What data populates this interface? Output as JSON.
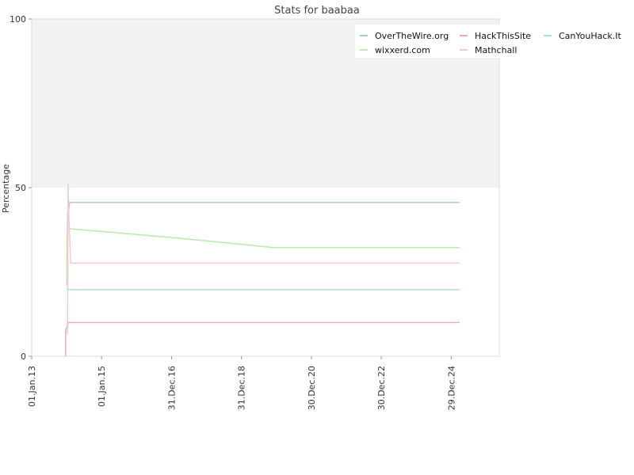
{
  "chart_data": {
    "type": "line",
    "title": "Stats for baabaa",
    "xlabel": "",
    "ylabel": "Percentage",
    "ylim": [
      0,
      100
    ],
    "yticks": [
      "0",
      "50",
      "100"
    ],
    "xlim": [
      "2013-01-01",
      "2026-05-15"
    ],
    "xticks": [
      {
        "label": "01.Jan.13",
        "date": "2013-01-01"
      },
      {
        "label": "01.Jan.15",
        "date": "2015-01-01"
      },
      {
        "label": "31.Dec.16",
        "date": "2016-12-31"
      },
      {
        "label": "31.Dec.18",
        "date": "2018-12-31"
      },
      {
        "label": "30.Dec.20",
        "date": "2020-12-30"
      },
      {
        "label": "30.Dec.22",
        "date": "2022-12-30"
      },
      {
        "label": "29.Dec.24",
        "date": "2024-12-29"
      }
    ],
    "shaded_band": [
      50,
      100
    ],
    "grid": false,
    "legend_position": "top-right",
    "series": [
      {
        "name": "OverTheWire.org",
        "color": "#a7c7e7",
        "points": [
          [
            "2014-01-05",
            31.0
          ],
          [
            "2014-01-12",
            42.7
          ],
          [
            "2014-01-20",
            43.0
          ],
          [
            "2014-02-01",
            45.6
          ],
          [
            "2025-03-26",
            45.6
          ]
        ]
      },
      {
        "name": "HackThisSite",
        "color": "#f4a6c6",
        "points": [
          [
            "2013-12-20",
            0.0
          ],
          [
            "2013-12-21",
            8.0
          ],
          [
            "2014-01-05",
            8.5
          ],
          [
            "2014-01-08",
            9.5
          ],
          [
            "2014-01-25",
            10.0
          ],
          [
            "2025-03-26",
            10.0
          ]
        ]
      },
      {
        "name": "CanYouHack.It",
        "color": "#a8e6cf",
        "points": [
          [
            "2013-12-28",
            20.0
          ],
          [
            "2014-01-15",
            19.8
          ],
          [
            "2025-03-26",
            19.8
          ]
        ]
      },
      {
        "name": "wixxerd.com",
        "color": "#b7eba7",
        "points": [
          [
            "2014-01-02",
            21.0
          ],
          [
            "2014-01-04",
            33.0
          ],
          [
            "2014-01-07",
            37.0
          ],
          [
            "2014-02-05",
            37.8
          ],
          [
            "2015-01-01",
            37.0
          ],
          [
            "2016-12-31",
            35.2
          ],
          [
            "2018-12-31",
            33.2
          ],
          [
            "2019-12-01",
            32.2
          ],
          [
            "2025-03-26",
            32.2
          ]
        ]
      },
      {
        "name": "Mathchall",
        "color": "#f8c8cc",
        "points": [
          [
            "2014-01-10",
            6.5
          ],
          [
            "2014-01-16",
            51.0
          ],
          [
            "2014-01-22",
            44.0
          ],
          [
            "2014-02-05",
            33.0
          ],
          [
            "2014-02-12",
            27.6
          ],
          [
            "2025-03-26",
            27.6
          ]
        ]
      }
    ]
  }
}
